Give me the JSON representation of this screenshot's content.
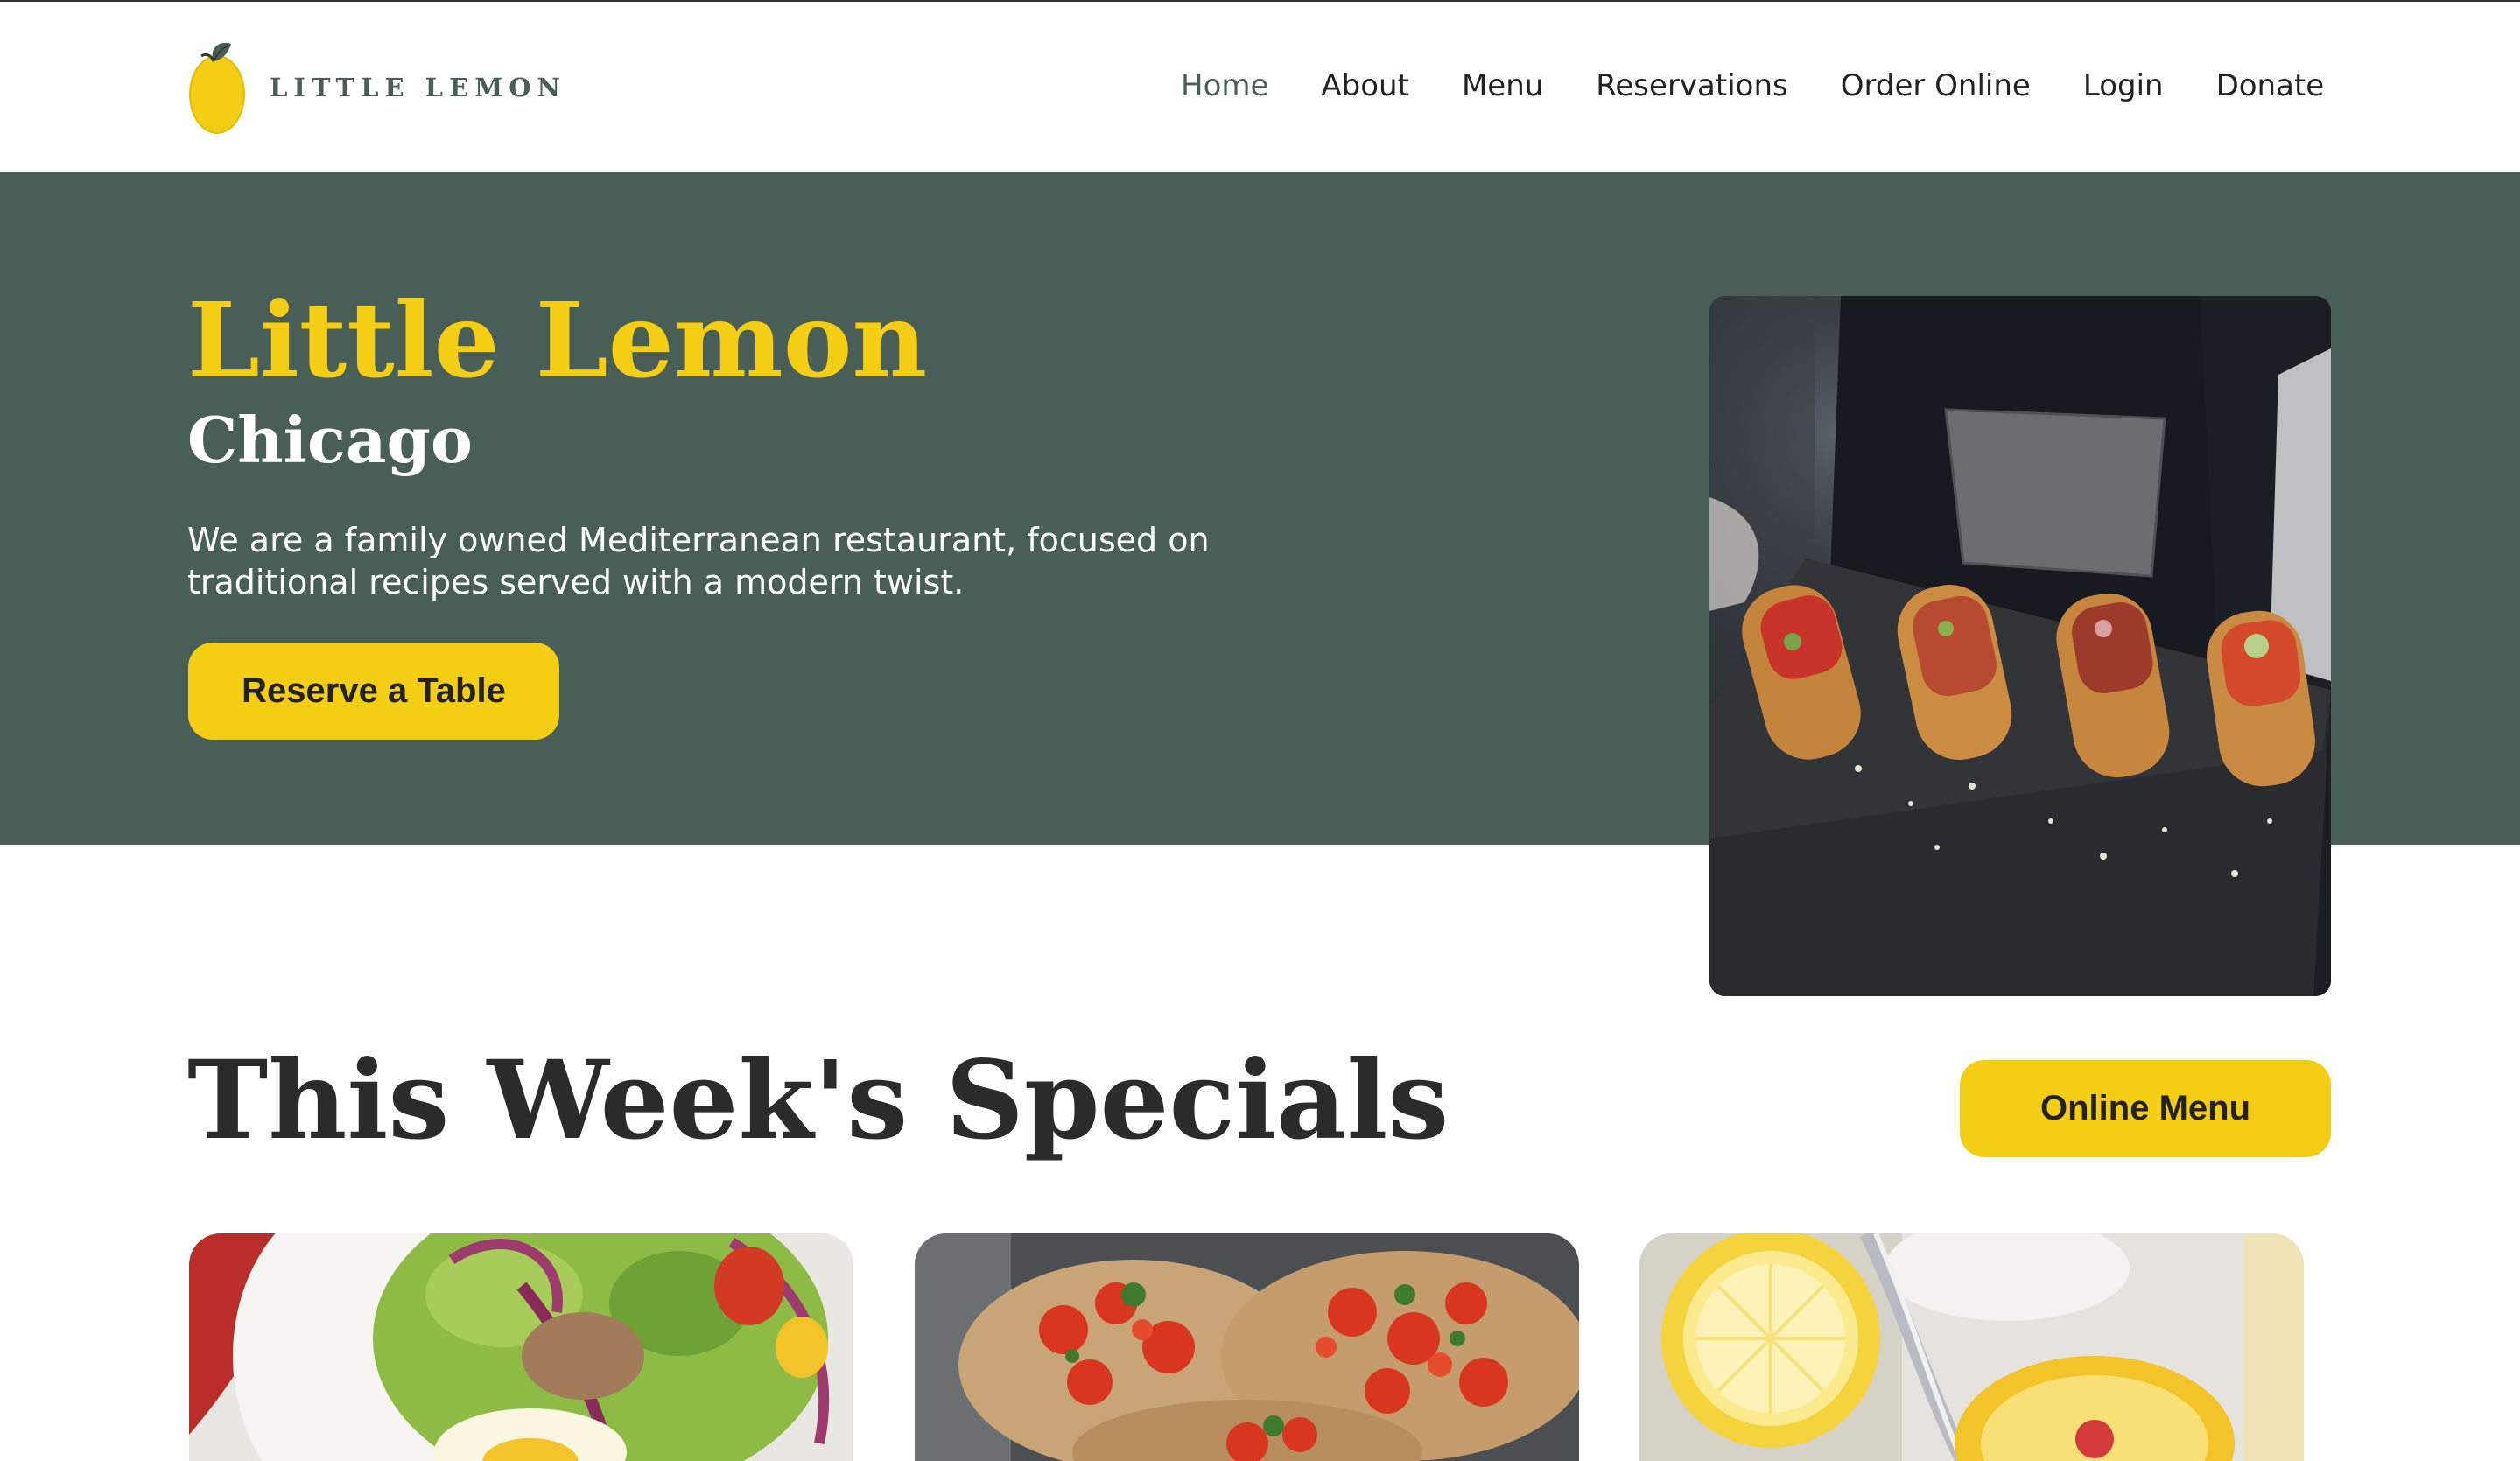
{
  "brand": {
    "name": "LITTLE LEMON",
    "logo_icon": "lemon-icon",
    "colors": {
      "primary_green": "#495e57",
      "accent_yellow": "#f4ce14",
      "text_dark": "#2b2b2b"
    }
  },
  "nav": {
    "items": [
      {
        "label": "Home",
        "active": true
      },
      {
        "label": "About"
      },
      {
        "label": "Menu"
      },
      {
        "label": "Reservations"
      },
      {
        "label": "Order Online"
      },
      {
        "label": "Login"
      },
      {
        "label": "Donate"
      }
    ]
  },
  "hero": {
    "title": "Little Lemon",
    "subtitle": "Chicago",
    "description": "We are a family owned Mediterranean restaurant, focused on traditional recipes served with a modern twist.",
    "cta_label": "Reserve a Table",
    "image": "waiter-holding-tray-of-bruschetta-photo"
  },
  "specials": {
    "title": "This Week's Specials",
    "button_label": "Online Menu",
    "cards": [
      {
        "image": "greek-salad-photo"
      },
      {
        "image": "bruschetta-photo"
      },
      {
        "image": "lemon-dessert-photo"
      }
    ]
  }
}
